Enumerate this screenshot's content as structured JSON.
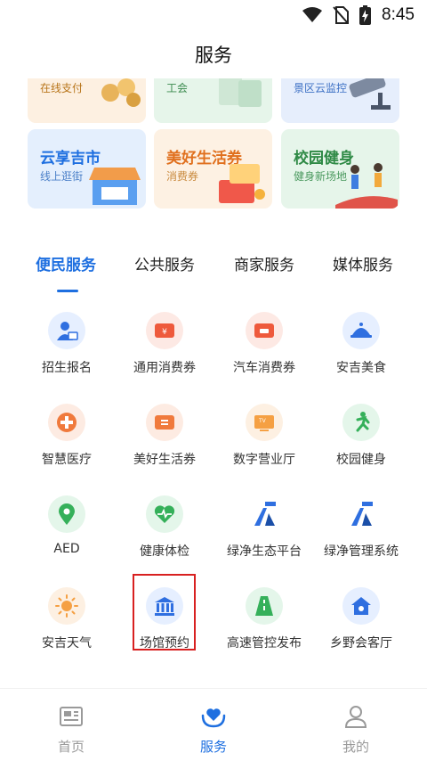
{
  "status_bar": {
    "time": "8:45"
  },
  "header": {
    "title": "服务"
  },
  "banners_top": [
    {
      "sub": "在线支付"
    },
    {
      "sub": "工会"
    },
    {
      "sub": "景区云监控"
    }
  ],
  "banners": [
    {
      "title": "云享吉市",
      "sub": "线上逛街"
    },
    {
      "title": "美好生活券",
      "sub": "消费券"
    },
    {
      "title": "校园健身",
      "sub": "健身新场地"
    }
  ],
  "tabs": [
    {
      "label": "便民服务",
      "active": true
    },
    {
      "label": "公共服务",
      "active": false
    },
    {
      "label": "商家服务",
      "active": false
    },
    {
      "label": "媒体服务",
      "active": false
    }
  ],
  "services": [
    {
      "label": "招生报名",
      "icon": "person-id-icon"
    },
    {
      "label": "通用消费券",
      "icon": "ticket-icon"
    },
    {
      "label": "汽车消费券",
      "icon": "car-ticket-icon"
    },
    {
      "label": "安吉美食",
      "icon": "food-dome-icon"
    },
    {
      "label": "智慧医疗",
      "icon": "medical-cross-icon"
    },
    {
      "label": "美好生活券",
      "icon": "coupon-icon"
    },
    {
      "label": "数字营业厅",
      "icon": "tv-icon"
    },
    {
      "label": "校园健身",
      "icon": "running-icon"
    },
    {
      "label": "AED",
      "icon": "location-pin-icon"
    },
    {
      "label": "健康体检",
      "icon": "heart-pulse-icon"
    },
    {
      "label": "绿净生态平台",
      "icon": "road-logo-icon"
    },
    {
      "label": "绿净管理系统",
      "icon": "road-logo-icon"
    },
    {
      "label": "安吉天气",
      "icon": "sun-icon"
    },
    {
      "label": "场馆预约",
      "icon": "venue-building-icon"
    },
    {
      "label": "高速管控发布",
      "icon": "highway-icon"
    },
    {
      "label": "乡野会客厅",
      "icon": "house-icon"
    }
  ],
  "bottom_nav": [
    {
      "label": "首页",
      "icon": "home-newspaper-icon",
      "active": false
    },
    {
      "label": "服务",
      "icon": "service-heart-icon",
      "active": true
    },
    {
      "label": "我的",
      "icon": "person-icon",
      "active": false
    }
  ],
  "colors": {
    "accent": "#1e6fe0",
    "highlight": "#d82020"
  }
}
